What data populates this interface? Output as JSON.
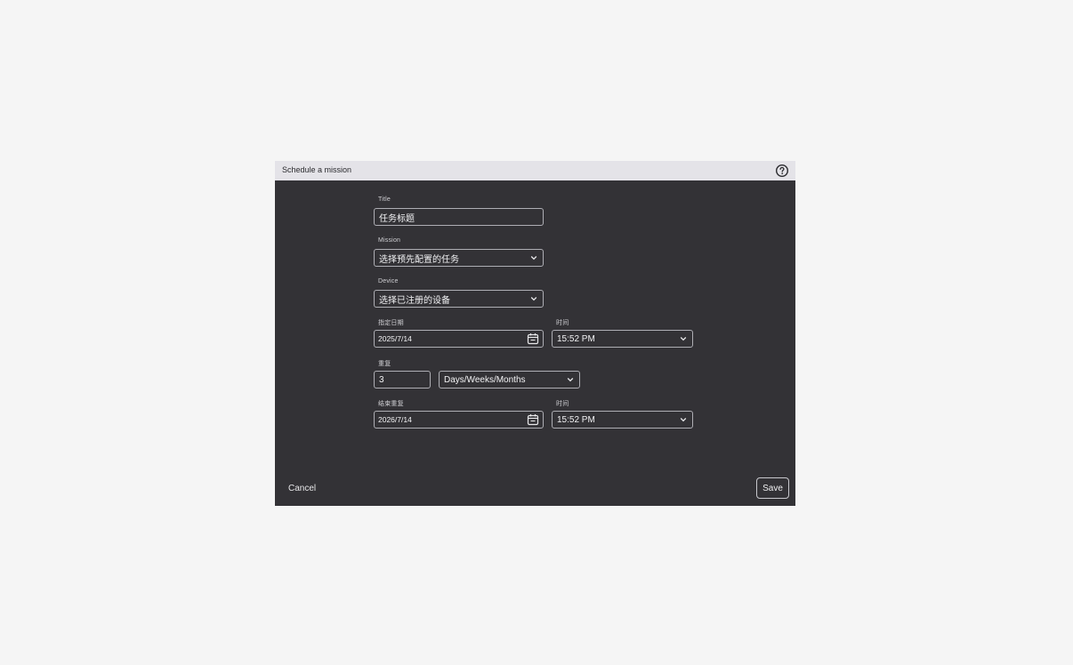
{
  "dialog": {
    "title": "Schedule a mission",
    "help_icon": "help-circle-icon"
  },
  "form": {
    "title": {
      "label": "Title",
      "value": "任务标题"
    },
    "mission": {
      "label": "Mission",
      "selected": "选择预先配置的任务"
    },
    "device": {
      "label": "Device",
      "selected": "选择已注册的设备"
    },
    "start_date": {
      "label": "指定日期",
      "value": "2025/7/14"
    },
    "start_time": {
      "label": "时间",
      "selected": "15:52 PM"
    },
    "repeat": {
      "label": "重复",
      "value": "3",
      "unit_selected": "Days/Weeks/Months"
    },
    "end_date": {
      "label": "结束重复",
      "value": "2026/7/14"
    },
    "end_time": {
      "label": "时间",
      "selected": "15:52 PM"
    }
  },
  "footer": {
    "cancel_label": "Cancel",
    "save_label": "Save"
  },
  "colors": {
    "dialog_bg": "#333236",
    "titlebar_bg": "#e4e3e8",
    "page_bg": "#f5f5f5",
    "field_border": "#aeaeb4"
  }
}
